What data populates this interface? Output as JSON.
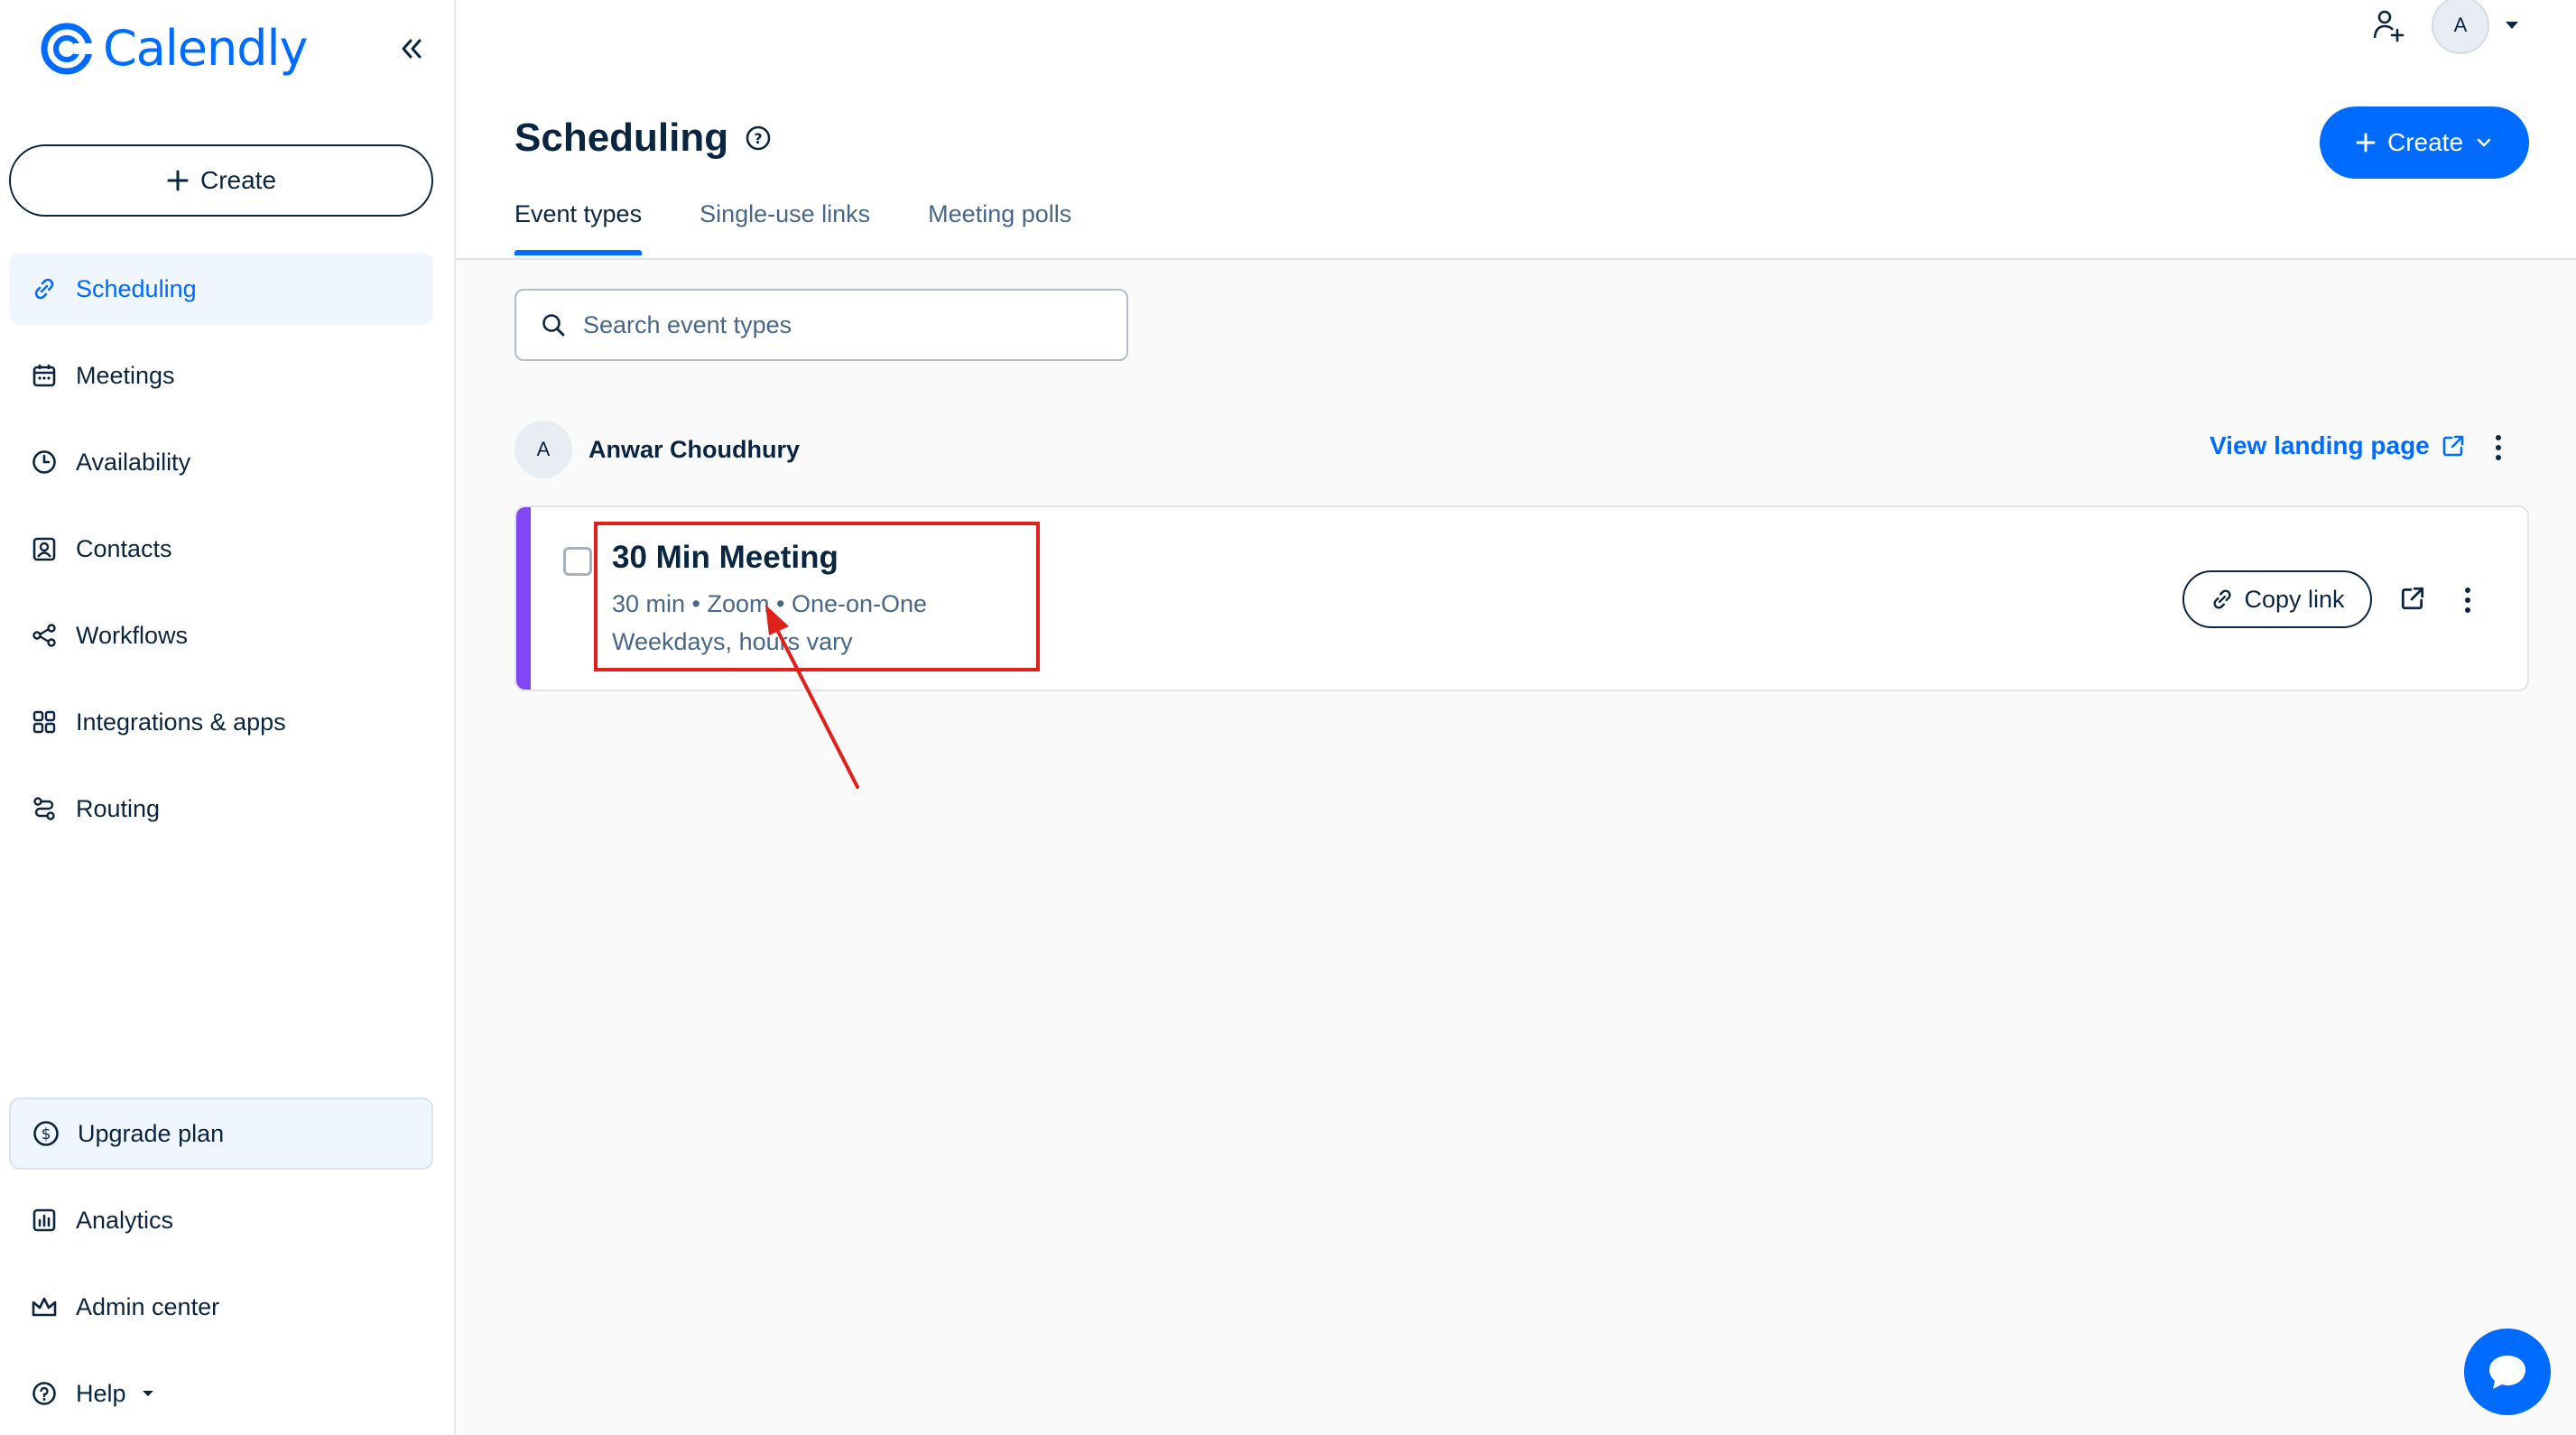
{
  "app": {
    "logo_text": "Calendly",
    "brand_color": "#006bff"
  },
  "sidebar": {
    "create_label": "Create",
    "items": [
      {
        "label": "Scheduling",
        "icon": "link-icon",
        "active": true
      },
      {
        "label": "Meetings",
        "icon": "calendar-icon"
      },
      {
        "label": "Availability",
        "icon": "clock-icon"
      },
      {
        "label": "Contacts",
        "icon": "contact-card-icon"
      },
      {
        "label": "Workflows",
        "icon": "workflow-icon"
      },
      {
        "label": "Integrations & apps",
        "icon": "grid-icon"
      },
      {
        "label": "Routing",
        "icon": "routing-icon"
      }
    ],
    "upgrade_label": "Upgrade plan",
    "bottom_items": [
      {
        "label": "Analytics",
        "icon": "bar-chart-icon"
      },
      {
        "label": "Admin center",
        "icon": "crown-icon"
      },
      {
        "label": "Help",
        "icon": "help-circle-icon"
      }
    ]
  },
  "topbar": {
    "avatar_initial": "A"
  },
  "header": {
    "title": "Scheduling",
    "create_label": "Create",
    "tabs": [
      {
        "label": "Event types",
        "active": true
      },
      {
        "label": "Single-use links"
      },
      {
        "label": "Meeting polls"
      }
    ]
  },
  "search": {
    "placeholder": "Search event types"
  },
  "owner": {
    "initial": "A",
    "name": "Anwar Choudhury",
    "landing_link": "View landing page"
  },
  "event_card": {
    "title": "30 Min Meeting",
    "meta": "30 min • Zoom • One-on-One",
    "schedule": "Weekdays, hours vary",
    "copy_link_label": "Copy link",
    "stripe_color": "#8247f5"
  },
  "annotation": {
    "highlight_color": "#e0201b"
  }
}
